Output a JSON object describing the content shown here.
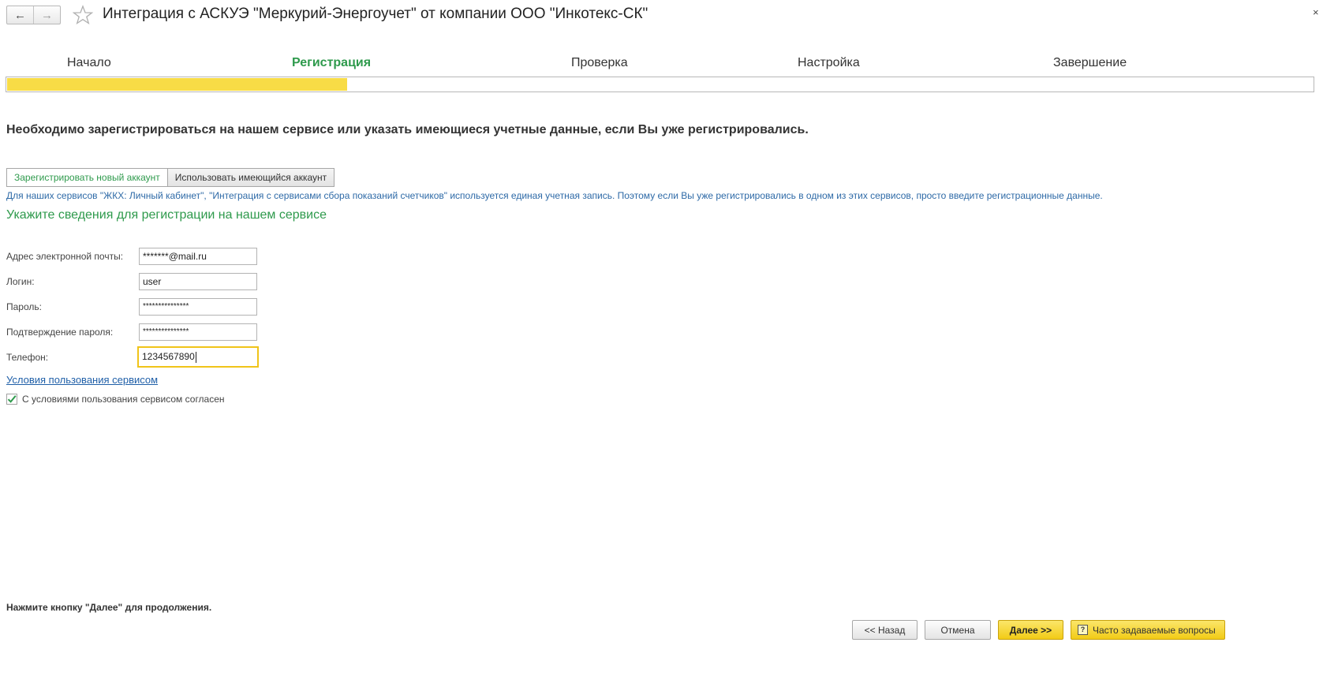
{
  "window": {
    "title": "Интеграция с АСКУЭ \"Меркурий-Энергоучет\" от компании ООО \"Инкотекс-СК\"",
    "back_icon": "←",
    "forward_icon": "→",
    "star_icon": "☆",
    "close_icon": "×"
  },
  "steps": [
    {
      "label": "Начало",
      "active": false
    },
    {
      "label": "Регистрация",
      "active": true
    },
    {
      "label": "Проверка",
      "active": false
    },
    {
      "label": "Настройка",
      "active": false
    },
    {
      "label": "Завершение",
      "active": false
    }
  ],
  "progress": {
    "percent": 26,
    "color": "#f8dc46"
  },
  "heading": "Необходимо зарегистрироваться на нашем сервисе или указать имеющиеся учетные данные, если Вы уже регистрировались.",
  "account_toggle": {
    "new_label": "Зарегистрировать новый аккаунт",
    "existing_label": "Использовать имеющийся аккаунт",
    "selected": "new"
  },
  "info_text": "Для наших сервисов \"ЖКХ: Личный кабинет\", \"Интеграция с сервисами сбора показаний счетчиков\" используется единая учетная запись. Поэтому если Вы уже регистрировались в одном из этих сервисов, просто введите регистрационные данные.",
  "subheading": "Укажите сведения для регистрации на нашем сервисе",
  "form": {
    "email": {
      "label": "Адрес электронной почты:",
      "value": "*******@mail.ru"
    },
    "login": {
      "label": "Логин:",
      "value": "user"
    },
    "password": {
      "label": "Пароль:",
      "value": "***************"
    },
    "password_confirm": {
      "label": "Подтверждение пароля:",
      "value": "***************"
    },
    "phone": {
      "label": "Телефон:",
      "value": "1234567890"
    }
  },
  "terms_link": "Условия пользования сервисом",
  "agree": {
    "label": "С условиями пользования сервисом согласен",
    "checked": true
  },
  "footnote": "Нажмите кнопку \"Далее\" для продолжения.",
  "buttons": {
    "back": "<< Назад",
    "cancel": "Отмена",
    "next": "Далее >>",
    "faq": "Часто задаваемые вопросы",
    "faq_icon": "?"
  },
  "colors": {
    "accent_green": "#2e9a4c",
    "link_blue": "#1f5fa8",
    "info_blue": "#2e6aa7",
    "button_yellow": "#f2cb16"
  }
}
